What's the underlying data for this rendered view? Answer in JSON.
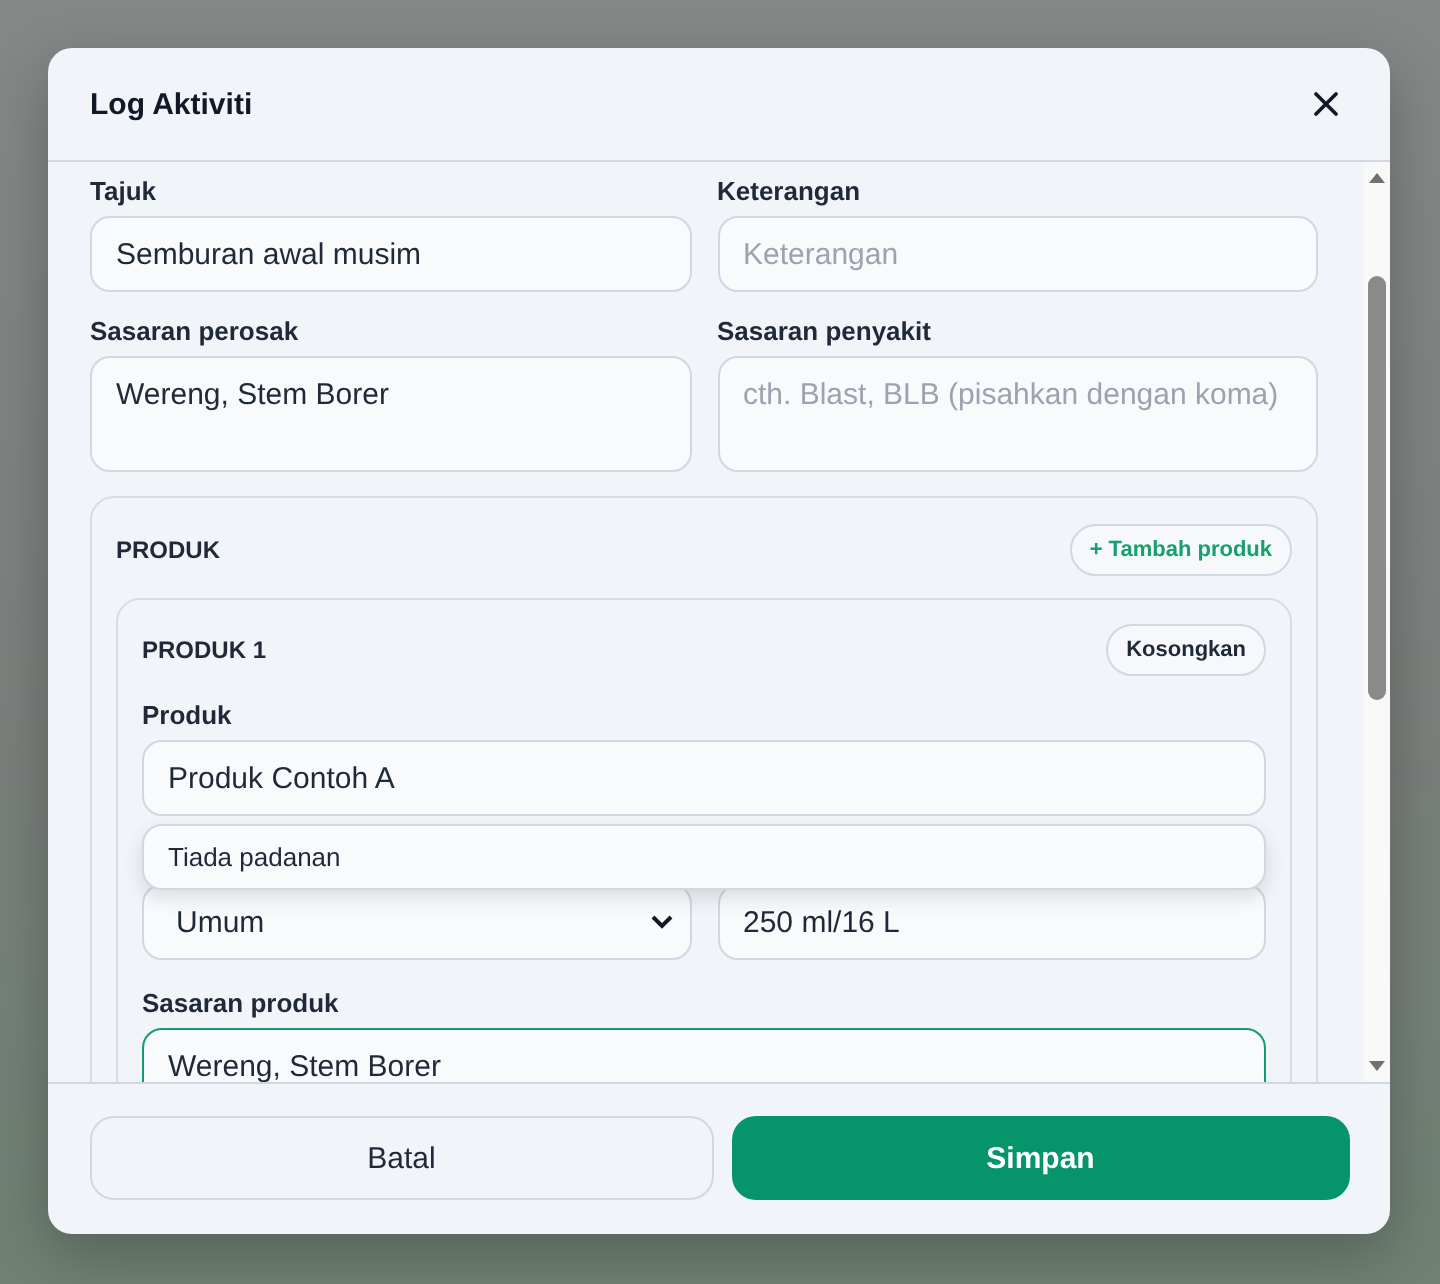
{
  "dialog": {
    "title": "Log Aktiviti"
  },
  "fields": [
    {
      "kind": "input",
      "label": "Tajuk",
      "value": "Semburan awal musim"
    },
    {
      "kind": "input",
      "label": "Keterangan",
      "placeholder": "Keterangan"
    },
    {
      "kind": "textarea",
      "label": "Sasaran perosak",
      "value": "Wereng, Stem Borer"
    },
    {
      "kind": "textarea",
      "label": "Sasaran penyakit",
      "placeholder": "cth. Blast, BLB (pisahkan dengan koma)"
    }
  ],
  "products": {
    "heading": "PRODUK",
    "add_button": "+ Tambah produk",
    "items": [
      {
        "heading": "PRODUK 1",
        "clear_button": "Kosongkan",
        "product_label": "Produk",
        "product_value": "Produk Contoh A",
        "suggestion": "Tiada padanan",
        "category_value": "Umum",
        "dose_value": "250 ml/16 L",
        "target_label": "Sasaran produk",
        "target_value": "Wereng, Stem Borer",
        "target_focused": true
      }
    ]
  },
  "buttons": {
    "cancel": "Batal",
    "save": "Simpan"
  }
}
